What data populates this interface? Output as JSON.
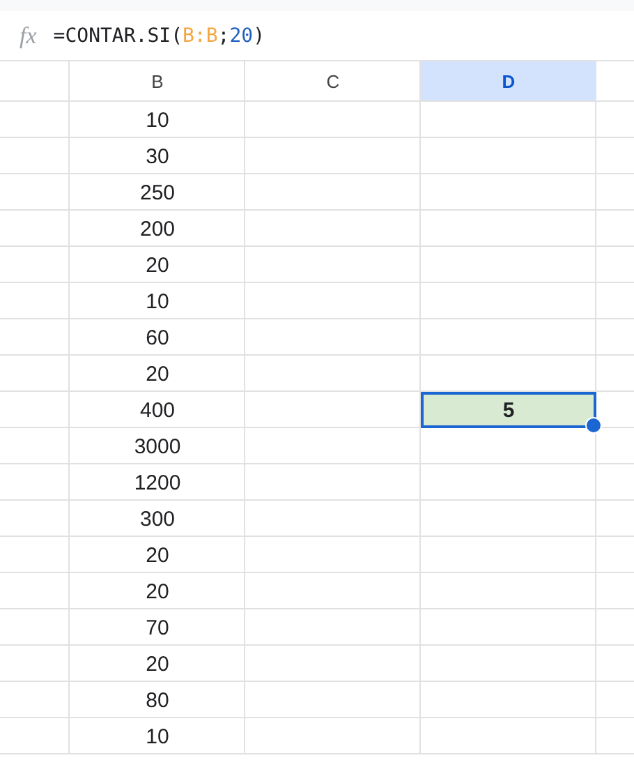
{
  "formula_bar": {
    "label": "fx",
    "formula": [
      {
        "kind": "text",
        "text": "=CONTAR.SI("
      },
      {
        "kind": "ref",
        "text": "B:B"
      },
      {
        "kind": "text",
        "text": ";"
      },
      {
        "kind": "number",
        "text": "20"
      },
      {
        "kind": "text",
        "text": ")"
      }
    ]
  },
  "columns": [
    {
      "label": "B",
      "selected": false
    },
    {
      "label": "C",
      "selected": false
    },
    {
      "label": "D",
      "selected": true
    }
  ],
  "rows": [
    {
      "b": "10"
    },
    {
      "b": "30"
    },
    {
      "b": "250"
    },
    {
      "b": "200"
    },
    {
      "b": "20"
    },
    {
      "b": "10"
    },
    {
      "b": "60"
    },
    {
      "b": "20"
    },
    {
      "b": "400",
      "d": {
        "value": "5",
        "selected": true
      }
    },
    {
      "b": "3000"
    },
    {
      "b": "1200"
    },
    {
      "b": "300"
    },
    {
      "b": "20"
    },
    {
      "b": "20"
    },
    {
      "b": "70"
    },
    {
      "b": "20"
    },
    {
      "b": "80"
    },
    {
      "b": "10"
    }
  ]
}
